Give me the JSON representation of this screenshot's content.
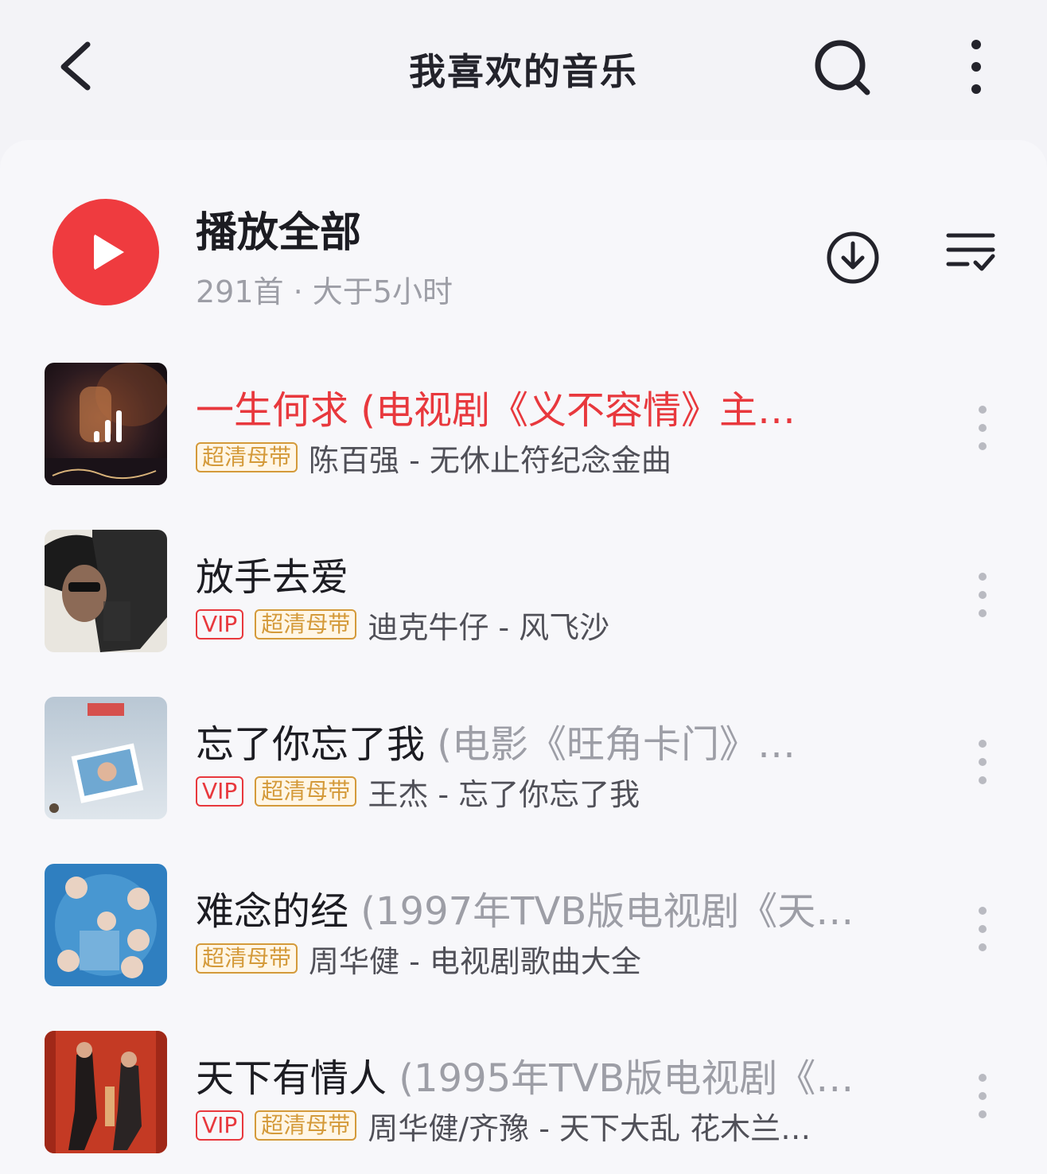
{
  "header": {
    "title": "我喜欢的音乐",
    "back_icon": "chevron-left-icon",
    "search_icon": "search-icon",
    "more_icon": "more-vertical-icon"
  },
  "play_all": {
    "label": "播放全部",
    "meta": "291首 · 大于5小时",
    "accent": "#ef3b3f"
  },
  "songs": [
    {
      "title": "一生何求 (电视剧《义不容情》主…",
      "subtitle": "",
      "playing": true,
      "vip": "",
      "quality": "超清母带",
      "artist_album": "陈百强 - 无休止符纪念金曲"
    },
    {
      "title": "放手去爱",
      "subtitle": "",
      "playing": false,
      "vip": "VIP",
      "quality": "超清母带",
      "artist_album": "迪克牛仔 - 风飞沙"
    },
    {
      "title": "忘了你忘了我",
      "subtitle": " (电影《旺角卡门》…",
      "playing": false,
      "vip": "VIP",
      "quality": "超清母带",
      "artist_album": "王杰 - 忘了你忘了我"
    },
    {
      "title": "难念的经",
      "subtitle": " (1997年TVB版电视剧《天…",
      "playing": false,
      "vip": "",
      "quality": "超清母带",
      "artist_album": "周华健 - 电视剧歌曲大全"
    },
    {
      "title": "天下有情人",
      "subtitle": " (1995年TVB版电视剧《…",
      "playing": false,
      "vip": "VIP",
      "quality": "超清母带",
      "artist_album": "周华健/齐豫 - 天下大乱 花木兰…"
    }
  ],
  "colors": {
    "playing_title": "#e8383d",
    "vip_tag": "#e8383d",
    "quality_tag": "#d49a3a"
  }
}
